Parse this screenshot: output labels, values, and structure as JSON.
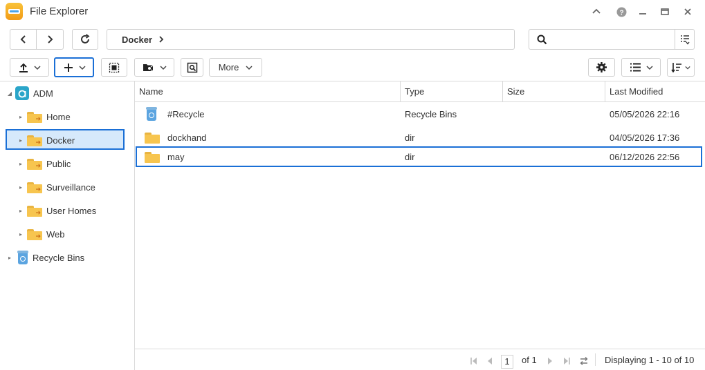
{
  "app": {
    "title": "File Explorer"
  },
  "address": {
    "crumb": "Docker"
  },
  "search": {
    "placeholder": "",
    "value": ""
  },
  "toolbar": {
    "more_label": "More"
  },
  "tree": {
    "root": "ADM",
    "items": [
      "Home",
      "Docker",
      "Public",
      "Surveillance",
      "User Homes",
      "Web"
    ],
    "recycle": "Recycle Bins"
  },
  "columns": {
    "name": "Name",
    "type": "Type",
    "size": "Size",
    "modified": "Last Modified"
  },
  "rows": [
    {
      "name": "#Recycle",
      "type": "Recycle Bins",
      "size": "",
      "modified": "05/05/2026 22:16",
      "icon": "recycle-bin-icon"
    },
    {
      "name": "dockhand",
      "type": "dir",
      "size": "",
      "modified": "04/05/2026 17:36",
      "icon": "folder-icon"
    },
    {
      "name": "may",
      "type": "dir",
      "size": "",
      "modified": "06/12/2026 22:56",
      "icon": "folder-icon"
    }
  ],
  "pager": {
    "page": "1",
    "of": "of 1",
    "display": "Displaying 1 - 10 of 10"
  },
  "colors": {
    "accent": "#1a6fd6",
    "selected_bg": "#d6e9fb",
    "folder": "#f7c54f"
  }
}
